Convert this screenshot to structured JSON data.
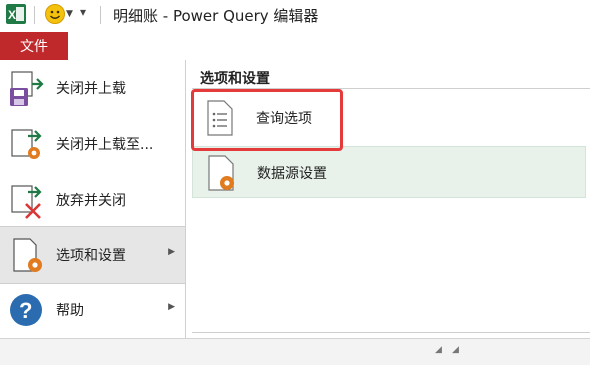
{
  "window": {
    "title": "明细账 - Power Query 编辑器"
  },
  "tabs": {
    "file_label": "文件"
  },
  "backstage_menu": {
    "items": [
      {
        "label": "关闭并上载",
        "icon": "close-and-load-icon"
      },
      {
        "label": "关闭并上载至...",
        "icon": "close-and-load-to-icon"
      },
      {
        "label": "放弃并关闭",
        "icon": "discard-and-close-icon"
      },
      {
        "label": "选项和设置",
        "icon": "options-settings-icon",
        "selected": true
      },
      {
        "label": "帮助",
        "icon": "help-icon"
      }
    ]
  },
  "options_panel": {
    "title": "选项和设置",
    "items": [
      {
        "label": "查询选项",
        "icon": "query-options-icon",
        "highlighted": true
      },
      {
        "label": "数据源设置",
        "icon": "data-source-settings-icon"
      }
    ]
  },
  "colors": {
    "file_tab": "#c0292b",
    "highlight": "#e53a3a",
    "hover_item": "#e8f2ea"
  }
}
